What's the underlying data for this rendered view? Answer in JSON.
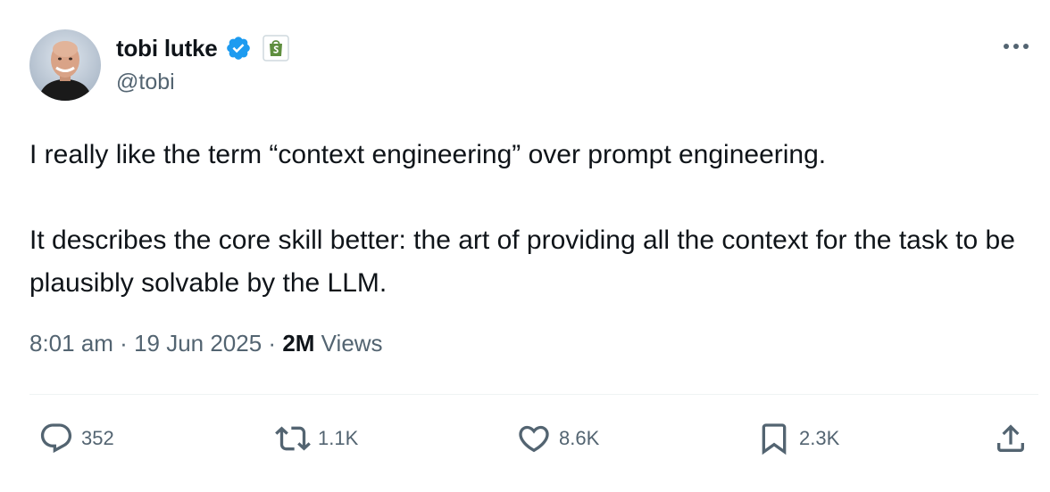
{
  "author": {
    "display_name": "tobi lutke",
    "handle": "@tobi",
    "verified": true,
    "affiliate_badge": "shopify-bag-icon"
  },
  "tweet": {
    "paragraphs": [
      "I really like the term “context engineering” over prompt engineering.",
      "It describes the core skill better: the art of providing all the context for the task to be plausibly solvable by the LLM."
    ]
  },
  "meta": {
    "time": "8:01 am",
    "separator": " · ",
    "date": "19 Jun 2025",
    "views_count": "2M",
    "views_label": "Views"
  },
  "actions": {
    "reply_count": "352",
    "retweet_count": "1.1K",
    "like_count": "8.6K",
    "bookmark_count": "2.3K"
  },
  "colors": {
    "primary_text": "#0f1419",
    "secondary_text": "#536471",
    "verified_blue": "#1d9bf0",
    "shopify_green": "#5e8e3e",
    "divider": "#eff3f4"
  },
  "icons": [
    "verified-icon",
    "shopify-bag-icon",
    "more-icon",
    "reply-icon",
    "retweet-icon",
    "like-icon",
    "bookmark-icon",
    "share-icon"
  ]
}
